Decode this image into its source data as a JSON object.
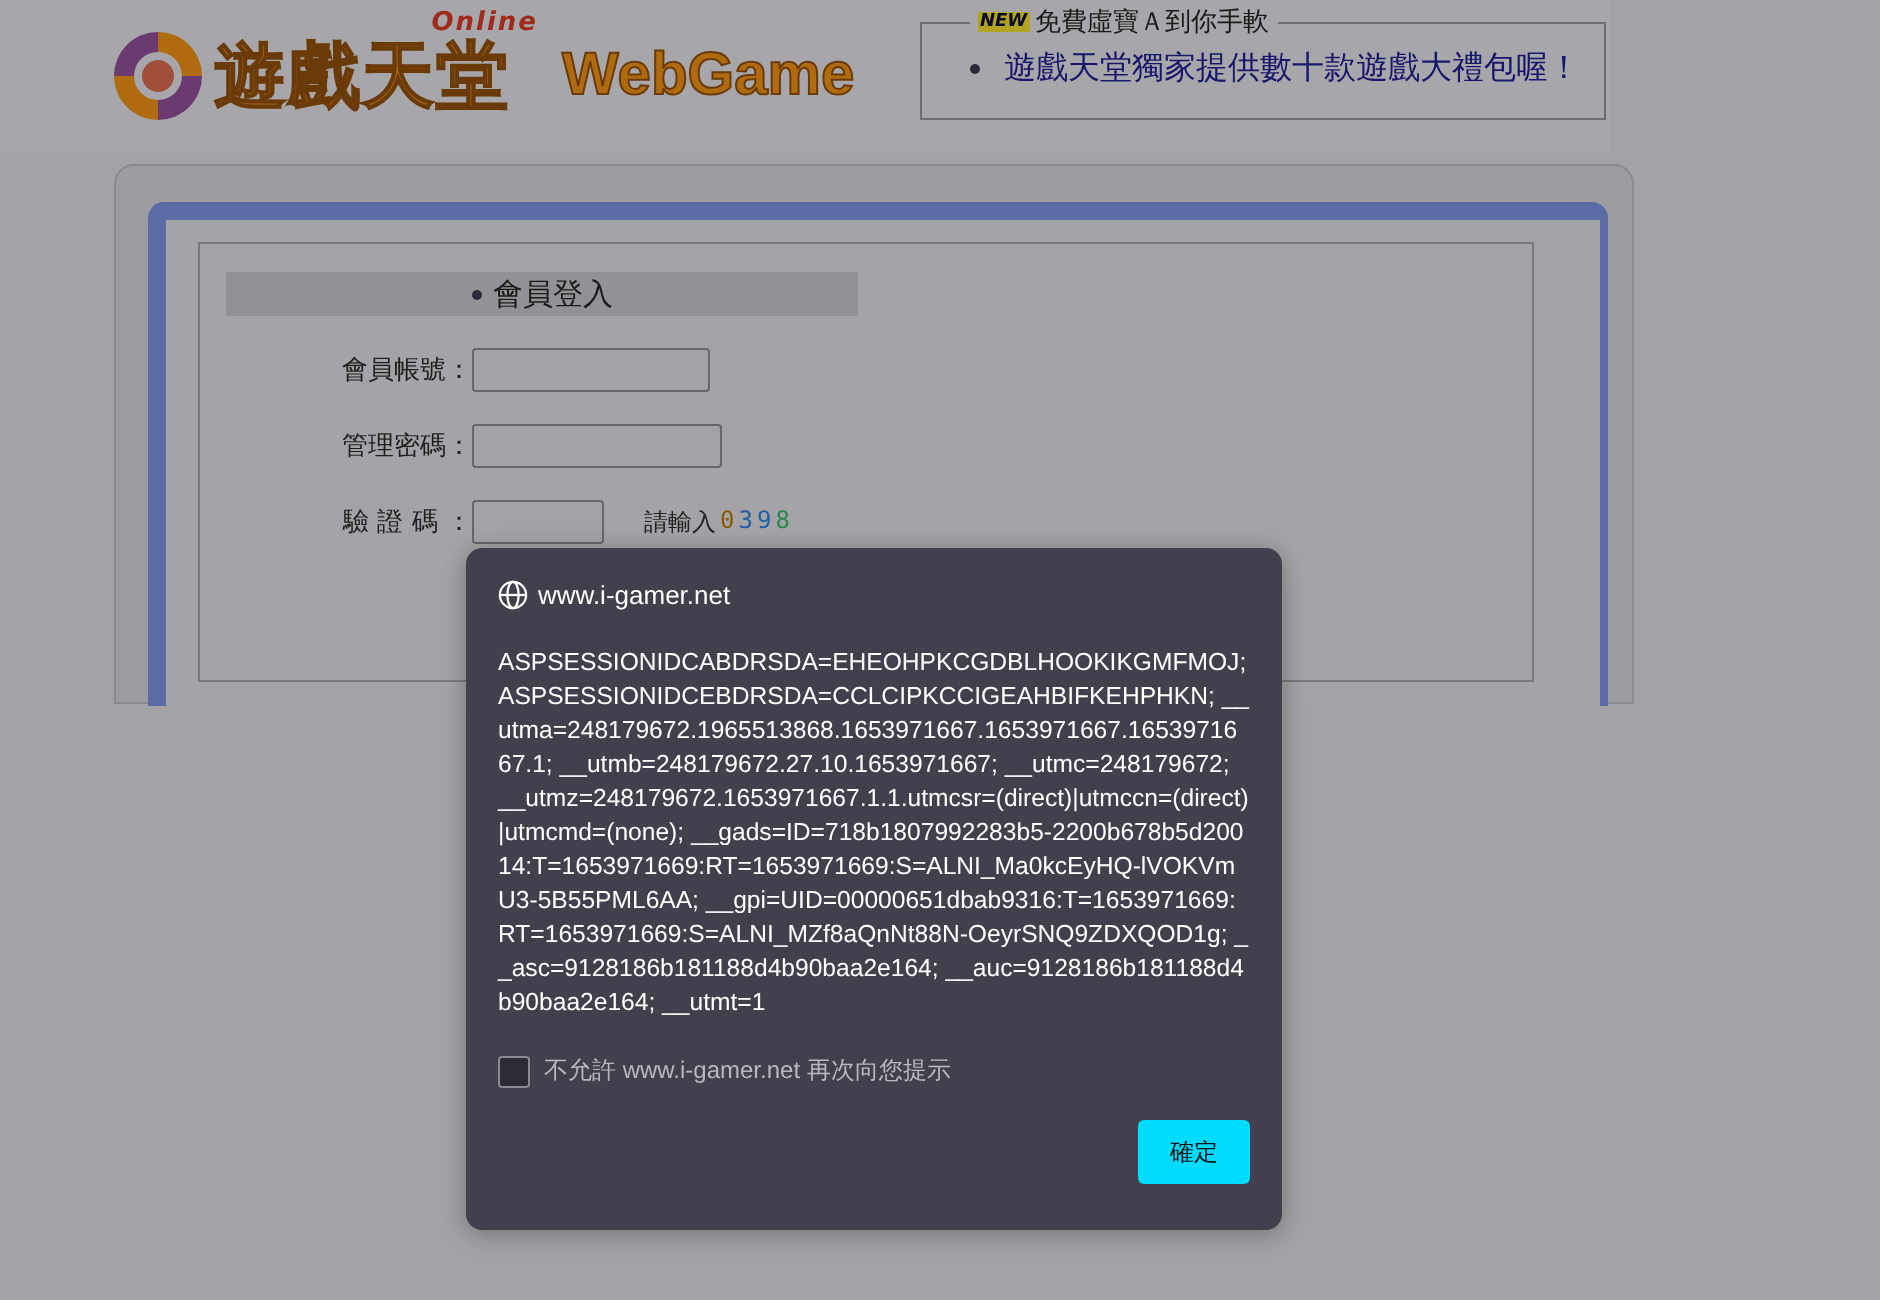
{
  "header": {
    "logo": {
      "title": "遊戲天堂",
      "tag": "Online",
      "product": "WebGame"
    },
    "news": {
      "badge": "NEW",
      "legend": "免費虛寶Ａ到你手軟",
      "items": [
        "遊戲天堂獨家提供數十款遊戲大禮包喔！"
      ]
    }
  },
  "login": {
    "title": "會員登入",
    "fields": [
      {
        "label": "會員帳號：",
        "kind": "text"
      },
      {
        "label": "管理密碼：",
        "kind": "password"
      },
      {
        "label": "驗 證 碼 ：",
        "kind": "captcha"
      }
    ],
    "captcha": {
      "hint": "請輸入",
      "digits": [
        {
          "text": "0",
          "color": "#8a5a00"
        },
        {
          "text": "3",
          "color": "#1f5fa0"
        },
        {
          "text": "9",
          "color": "#1f5fa0"
        },
        {
          "text": "8",
          "color": "#2a8a4a"
        }
      ]
    }
  },
  "dialog": {
    "site": "www.i-gamer.net",
    "message": "ASPSESSIONIDCABDRSDA=EHEOHPKCGDBLHOOKIKGMFMOJ; ASPSESSIONIDCEBDRSDA=CCLCIPKCCIGEAHBIFKEHPHKN; __utma=248179672.1965513868.1653971667.1653971667.1653971667.1; __utmb=248179672.27.10.1653971667; __utmc=248179672; __utmz=248179672.1653971667.1.1.utmcsr=(direct)|utmccn=(direct)|utmcmd=(none); __gads=ID=718b1807992283b5-2200b678b5d20014:T=1653971669:RT=1653971669:S=ALNI_Ma0kcEyHQ-lVOKVmU3-5B55PML6AA; __gpi=UID=00000651dbab9316:T=1653971669:RT=1653971669:S=ALNI_MZf8aQnNt88N-OeyrSNQ9ZDXQOD1g; __asc=9128186b181188d4b90baa2e164; __auc=9128186b181188d4b90baa2e164; __utmt=1",
    "checkbox": {
      "label": "不允許 www.i-gamer.net 再次向您提示",
      "checked": false
    },
    "button": "確定"
  }
}
